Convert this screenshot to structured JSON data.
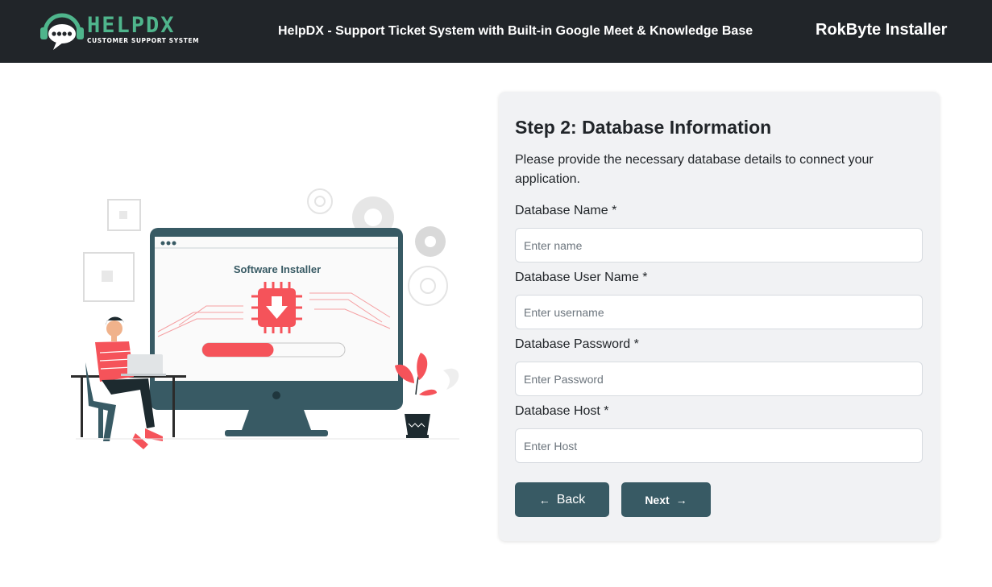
{
  "header": {
    "logo_text": "HELPDX",
    "logo_tagline": "CUSTOMER SUPPORT SYSTEM",
    "title": "HelpDX - Support Ticket System with Built-in Google Meet & Knowledge Base",
    "brand": "RokByte Installer"
  },
  "illustration": {
    "screen_title": "Software Installer",
    "progress": 0.5
  },
  "form": {
    "title": "Step 2: Database Information",
    "description": "Please provide the necessary database details to connect your application.",
    "fields": [
      {
        "label": "Database Name *",
        "placeholder": "Enter name",
        "value": ""
      },
      {
        "label": "Database User Name *",
        "placeholder": "Enter username",
        "value": ""
      },
      {
        "label": "Database Password *",
        "placeholder": "Enter Password",
        "value": ""
      },
      {
        "label": "Database Host *",
        "placeholder": "Enter Host",
        "value": ""
      }
    ],
    "back_label": "Back",
    "next_label": "Next",
    "back_icon": "arrow-left-icon",
    "next_icon": "arrow-right-icon"
  },
  "colors": {
    "header_bg": "#212529",
    "accent": "#385a64",
    "logo_green": "#4fb58c",
    "illustration_red": "#f5535a"
  }
}
